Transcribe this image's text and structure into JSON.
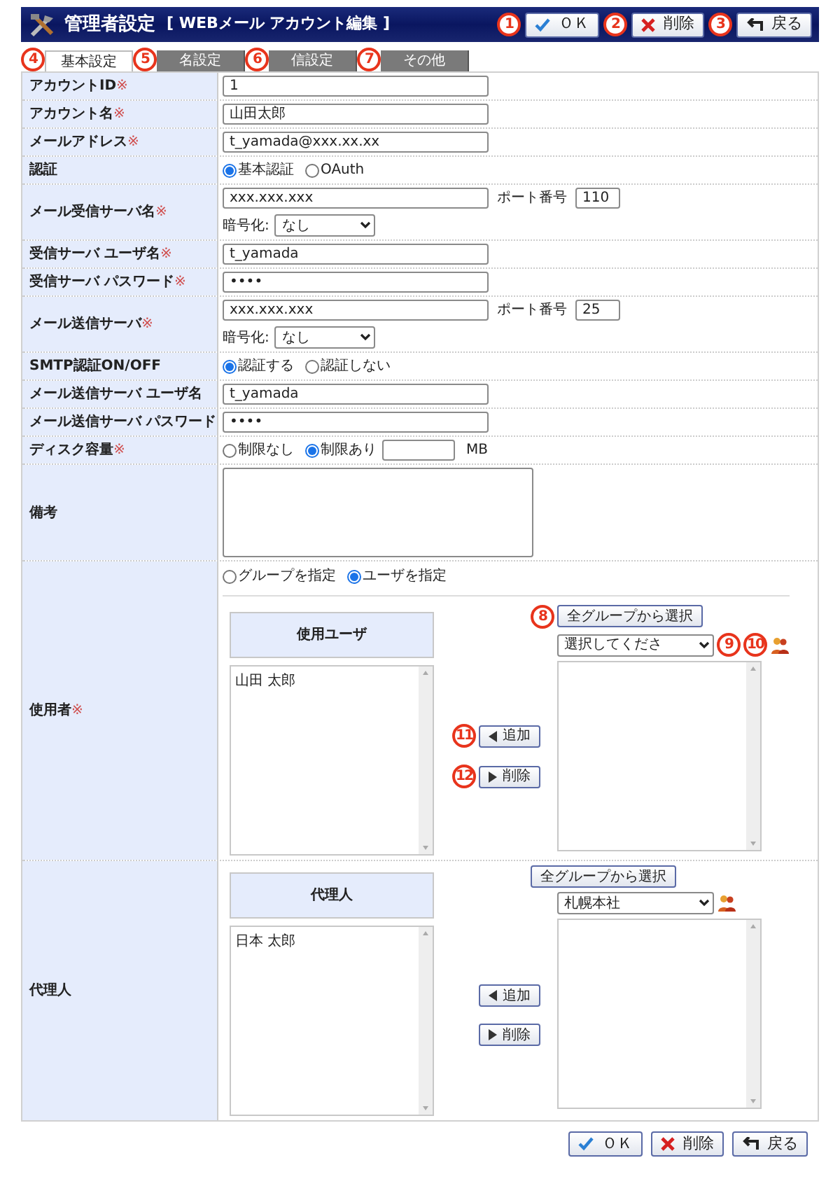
{
  "header": {
    "title": "管理者設定",
    "subtitle": "[ WEBメール アカウント編集 ]",
    "buttons": [
      {
        "kind": "ok",
        "label": "ＯＫ"
      },
      {
        "kind": "delete",
        "label": "削除"
      },
      {
        "kind": "back",
        "label": "戻る"
      }
    ]
  },
  "tabs": [
    {
      "label": "基本設定",
      "selected": true
    },
    {
      "label": "名設定",
      "selected": false
    },
    {
      "label": "信設定",
      "selected": false
    },
    {
      "label": "その他",
      "selected": false
    }
  ],
  "required_mark": "※",
  "rows": [
    {
      "kind": "text",
      "label": "アカウントID",
      "required": true,
      "value": "1"
    },
    {
      "kind": "text",
      "label": "アカウント名",
      "required": true,
      "value": "山田太郎"
    },
    {
      "kind": "text",
      "label": "メールアドレス",
      "required": true,
      "value": "t_yamada@xxx.xx.xx"
    },
    {
      "kind": "radio",
      "label": "認証",
      "required": false,
      "options": [
        {
          "label": "基本認証",
          "selected": true
        },
        {
          "label": "OAuth",
          "selected": false
        }
      ]
    },
    {
      "kind": "server",
      "label": "メール受信サーバ名",
      "required": true,
      "value": "xxx.xxx.xxx",
      "port_label": "ポート番号",
      "port": "110",
      "enc_label": "暗号化:",
      "enc": "なし"
    },
    {
      "kind": "text",
      "label": "受信サーバ ユーザ名",
      "required": true,
      "value": "t_yamada"
    },
    {
      "kind": "text",
      "label": "受信サーバ パスワード",
      "required": true,
      "value": "••••"
    },
    {
      "kind": "server",
      "label": "メール送信サーバ",
      "required": true,
      "value": "xxx.xxx.xxx",
      "port_label": "ポート番号",
      "port": "25",
      "enc_label": "暗号化:",
      "enc": "なし"
    },
    {
      "kind": "radio",
      "label": "SMTP認証ON/OFF",
      "required": false,
      "options": [
        {
          "label": "認証する",
          "selected": true
        },
        {
          "label": "認証しない",
          "selected": false
        }
      ]
    },
    {
      "kind": "text",
      "label": "メール送信サーバ ユーザ名",
      "required": false,
      "value": "t_yamada"
    },
    {
      "kind": "text",
      "label": "メール送信サーバ パスワード",
      "required": false,
      "value": "••••"
    },
    {
      "kind": "disk",
      "label": "ディスク容量",
      "required": true,
      "options": [
        {
          "label": "制限なし",
          "selected": false
        },
        {
          "label": "制限あり",
          "selected": true
        }
      ],
      "unit": "MB"
    },
    {
      "kind": "textarea",
      "label": "備考",
      "required": false
    },
    {
      "kind": "picker",
      "label": "使用者",
      "required": true,
      "options": [
        {
          "label": "グループを指定",
          "selected": false
        },
        {
          "label": "ユーザを指定",
          "selected": true
        }
      ],
      "list_title": "使用ユーザ",
      "members": [
        "山田 太郎"
      ],
      "group_button": "全グループから選択",
      "group": "選択してくださ",
      "add": "追加",
      "remove": "削除"
    },
    {
      "kind": "picker",
      "label": "代理人",
      "required": false,
      "list_title": "代理人",
      "members": [
        "日本 太郎"
      ],
      "group_button": "全グループから選択",
      "group": "札幌本社",
      "add": "追加",
      "remove": "削除"
    }
  ],
  "footer_buttons": [
    {
      "kind": "ok",
      "label": "ＯＫ"
    },
    {
      "kind": "delete",
      "label": "削除"
    },
    {
      "kind": "back",
      "label": "戻る"
    }
  ],
  "annotations": [
    "1",
    "2",
    "3",
    "4",
    "5",
    "6",
    "7",
    "8",
    "9",
    "10",
    "11",
    "12"
  ]
}
